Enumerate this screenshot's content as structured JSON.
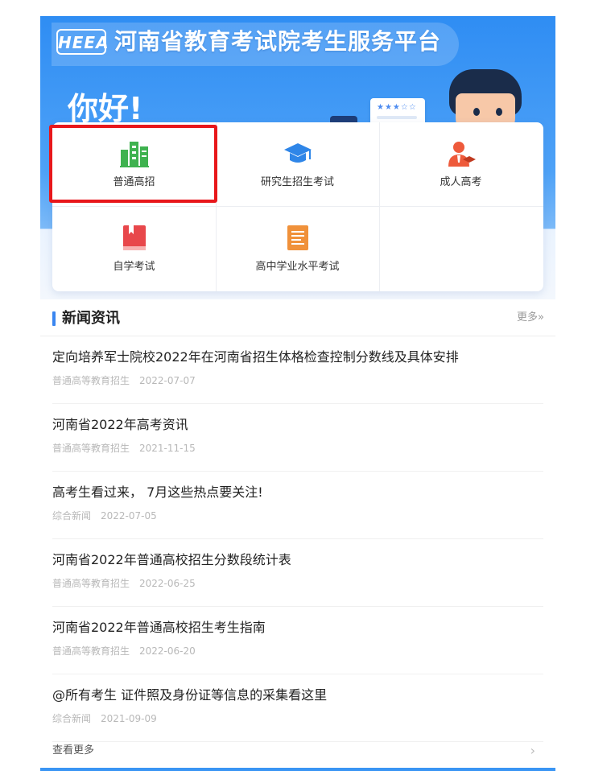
{
  "header": {
    "logo_text": "HEEA",
    "platform_title": "河南省教育考试院考生服务平台",
    "greeting": "你好!"
  },
  "services": [
    {
      "label": "普通高招",
      "icon": "building-icon",
      "color": "#3fb24f"
    },
    {
      "label": "研究生招生考试",
      "icon": "graduation-cap-icon",
      "color": "#2f86e8"
    },
    {
      "label": "成人高考",
      "icon": "person-icon",
      "color": "#ee5a3b"
    },
    {
      "label": "自学考试",
      "icon": "book-icon",
      "color": "#e8474b"
    },
    {
      "label": "高中学业水平考试",
      "icon": "document-icon",
      "color": "#f0913a"
    }
  ],
  "news": {
    "title": "新闻资讯",
    "more_label": "更多»",
    "items": [
      {
        "headline": "定向培养军士院校2022年在河南省招生体格检查控制分数线及具体安排",
        "category": "普通高等教育招生",
        "date": "2022-07-07"
      },
      {
        "headline": "河南省2022年高考资讯",
        "category": "普通高等教育招生",
        "date": "2021-11-15"
      },
      {
        "headline": "高考生看过来， 7月这些热点要关注!",
        "category": "综合新闻",
        "date": "2022-07-05"
      },
      {
        "headline": "河南省2022年普通高校招生分数段统计表",
        "category": "普通高等教育招生",
        "date": "2022-06-25"
      },
      {
        "headline": "河南省2022年普通高校招生考生指南",
        "category": "普通高等教育招生",
        "date": "2022-06-20"
      },
      {
        "headline": "@所有考生 证件照及身份证等信息的采集看这里",
        "category": "综合新闻",
        "date": "2021-09-09"
      }
    ],
    "view_more_label": "查看更多",
    "chevron": "›"
  },
  "colors": {
    "brand_blue": "#2f8df3",
    "accent_bar": "#3a86f0",
    "highlight_red": "#e8171b"
  }
}
